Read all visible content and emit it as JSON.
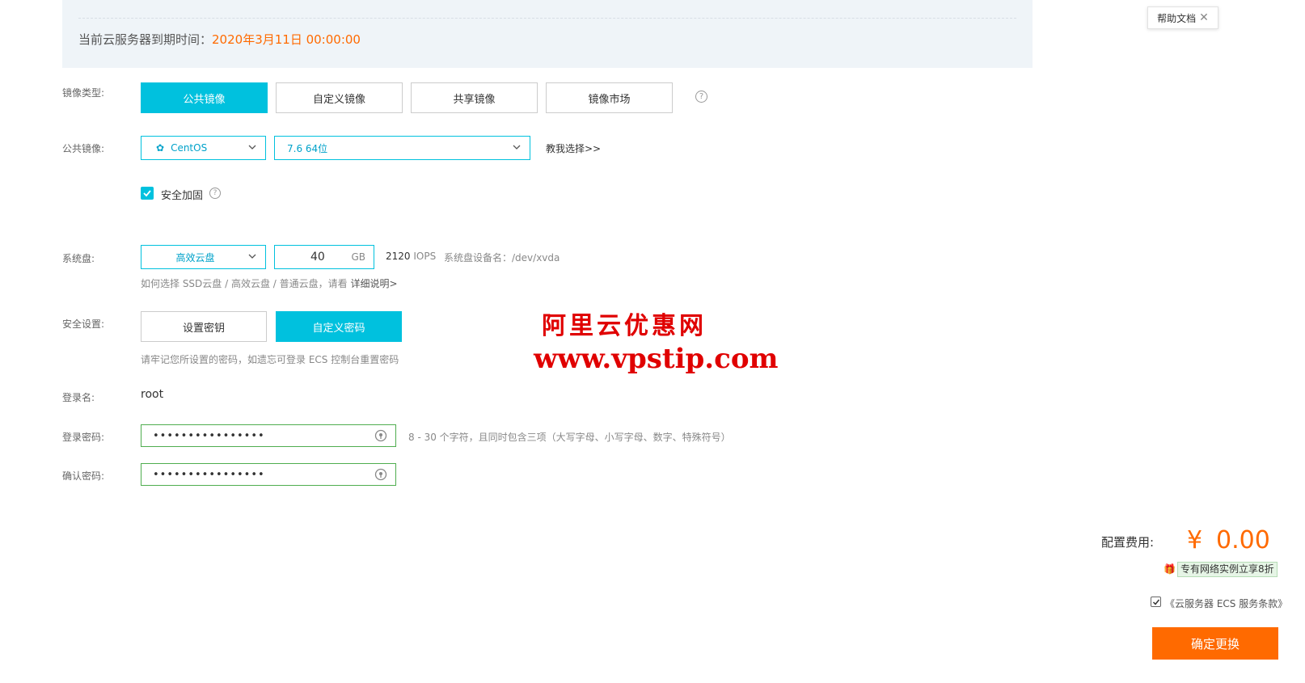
{
  "expiry": {
    "label": "当前云服务器到期时间：",
    "value": "2020年3月11日 00:00:00"
  },
  "help_tip": {
    "label": "帮助文档",
    "close": "✕"
  },
  "image_type": {
    "label": "镜像类型:",
    "options": [
      "公共镜像",
      "自定义镜像",
      "共享镜像",
      "镜像市场"
    ],
    "help": "?"
  },
  "public_image": {
    "label": "公共镜像:",
    "os": "CentOS",
    "version": "7.6 64位",
    "guide_link": "教我选择>>"
  },
  "security_harden": {
    "label": "安全加固",
    "help": "?"
  },
  "system_disk": {
    "label": "系统盘:",
    "type": "高效云盘",
    "size": "40",
    "unit": "GB",
    "iops_value": "2120",
    "iops_unit": "IOPS",
    "device_label": "系统盘设备名：/dev/xvda",
    "hint_prefix": "如何选择 SSD云盘 / 高效云盘 / 普通云盘，请看 ",
    "hint_link": "详细说明>"
  },
  "security_setting": {
    "label": "安全设置:",
    "options": [
      "设置密钥",
      "自定义密码"
    ],
    "hint": "请牢记您所设置的密码，如遗忘可登录 ECS 控制台重置密码"
  },
  "login_name": {
    "label": "登录名:",
    "value": "root"
  },
  "login_password": {
    "label": "登录密码:",
    "value": "••••••••••••••••",
    "hint": "8 - 30 个字符，且同时包含三项（大写字母、小写字母、数字、特殊符号）"
  },
  "confirm_password": {
    "label": "确认密码:",
    "value": "••••••••••••••••"
  },
  "watermark": {
    "line1": "阿里云优惠网",
    "line2": "www.vpstip.com"
  },
  "cost": {
    "label": "配置费用:",
    "currency": "¥",
    "amount": "0.00",
    "promo": "专有网络实例立享8折",
    "terms": "《云服务器 ECS 服务条款》"
  },
  "confirm_button": "确定更换",
  "colors": {
    "accent": "#00c1de",
    "orange": "#ff6a00",
    "watermark": "#e00000",
    "valid": "#4fad4f"
  }
}
